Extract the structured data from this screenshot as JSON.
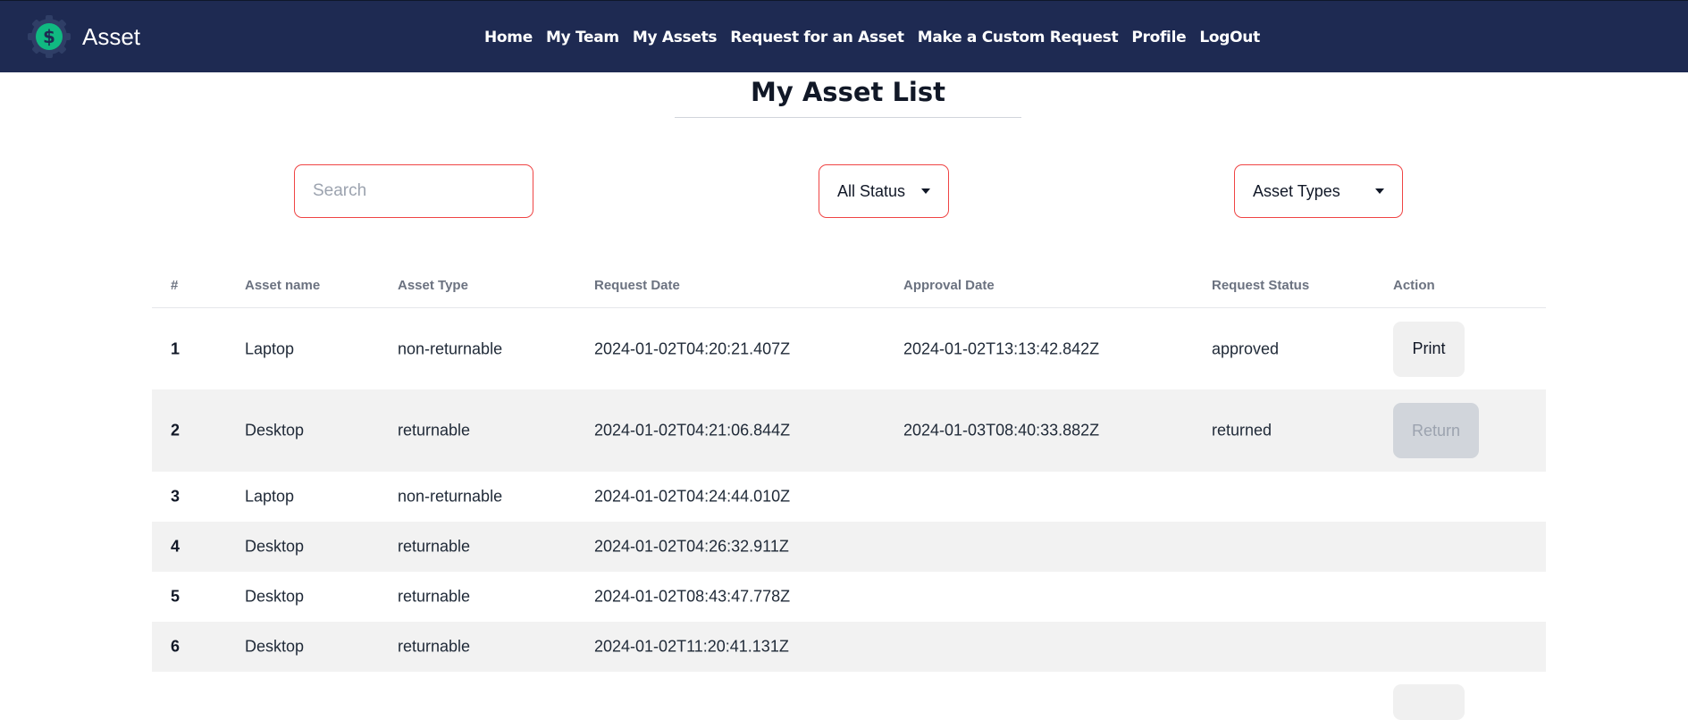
{
  "brand": {
    "name": "Asset",
    "logo_icon": "dollar-gear-icon",
    "logo_color": "#10b981"
  },
  "nav": {
    "links": [
      "Home",
      "My Team",
      "My Assets",
      "Request for an Asset",
      "Make a Custom Request",
      "Profile",
      "LogOut"
    ]
  },
  "page": {
    "title": "My Asset List"
  },
  "filters": {
    "search_placeholder": "Search",
    "status_selected": "All Status",
    "type_selected": "Asset Types"
  },
  "table": {
    "headers": [
      "#",
      "Asset name",
      "Asset Type",
      "Request Date",
      "Approval Date",
      "Request Status",
      "Action"
    ],
    "rows": [
      {
        "n": "1",
        "name": "Laptop",
        "type": "non-returnable",
        "request_date": "2024-01-02T04:20:21.407Z",
        "approval_date": "2024-01-02T13:13:42.842Z",
        "status": "approved",
        "action": "Print"
      },
      {
        "n": "2",
        "name": "Desktop",
        "type": "returnable",
        "request_date": "2024-01-02T04:21:06.844Z",
        "approval_date": "2024-01-03T08:40:33.882Z",
        "status": "returned",
        "action": "Return"
      },
      {
        "n": "3",
        "name": "Laptop",
        "type": "non-returnable",
        "request_date": "2024-01-02T04:24:44.010Z",
        "approval_date": "",
        "status": "",
        "action": ""
      },
      {
        "n": "4",
        "name": "Desktop",
        "type": "returnable",
        "request_date": "2024-01-02T04:26:32.911Z",
        "approval_date": "",
        "status": "",
        "action": ""
      },
      {
        "n": "5",
        "name": "Desktop",
        "type": "returnable",
        "request_date": "2024-01-02T08:43:47.778Z",
        "approval_date": "",
        "status": "",
        "action": ""
      },
      {
        "n": "6",
        "name": "Desktop",
        "type": "returnable",
        "request_date": "2024-01-02T11:20:41.131Z",
        "approval_date": "",
        "status": "",
        "action": ""
      }
    ]
  },
  "colors": {
    "navbar": "#1e2a52",
    "filter_border": "#ef4444",
    "stripe": "#f2f2f2"
  }
}
